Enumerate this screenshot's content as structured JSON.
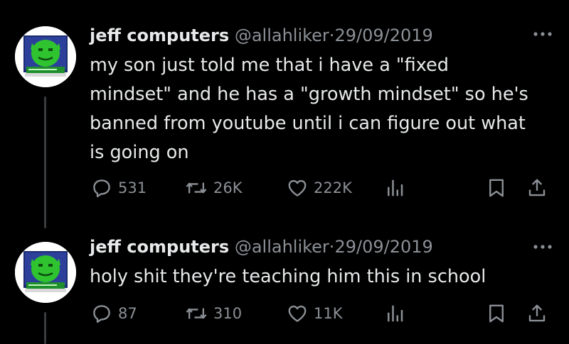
{
  "tweets": [
    {
      "author": {
        "name": "jeff computers",
        "handle": "@allahliker",
        "separator": "·",
        "date": "29/09/2019"
      },
      "text": "my son just told me that i have a \"fixed\nmindset\" and he has a \"growth mindset\" so he's\nbanned from youtube until i can figure out what\nis going on",
      "metrics": {
        "replies": "531",
        "reposts": "26K",
        "likes": "222K"
      }
    },
    {
      "author": {
        "name": "jeff computers",
        "handle": "@allahliker",
        "separator": "·",
        "date": "29/09/2019"
      },
      "text": "holy shit they're teaching him this in school",
      "metrics": {
        "replies": "87",
        "reposts": "310",
        "likes": "11K"
      }
    }
  ],
  "icons": {
    "reply": "reply-icon",
    "repost": "repost-icon",
    "like": "heart-icon",
    "views": "views-icon",
    "bookmark": "bookmark-icon",
    "share": "share-icon",
    "more": "more-icon"
  },
  "colors": {
    "background": "#000000",
    "text": "#e7e9ea",
    "muted": "#8b9096",
    "thread_line": "#3a3d40",
    "avatar_green": "#2fc42f"
  }
}
